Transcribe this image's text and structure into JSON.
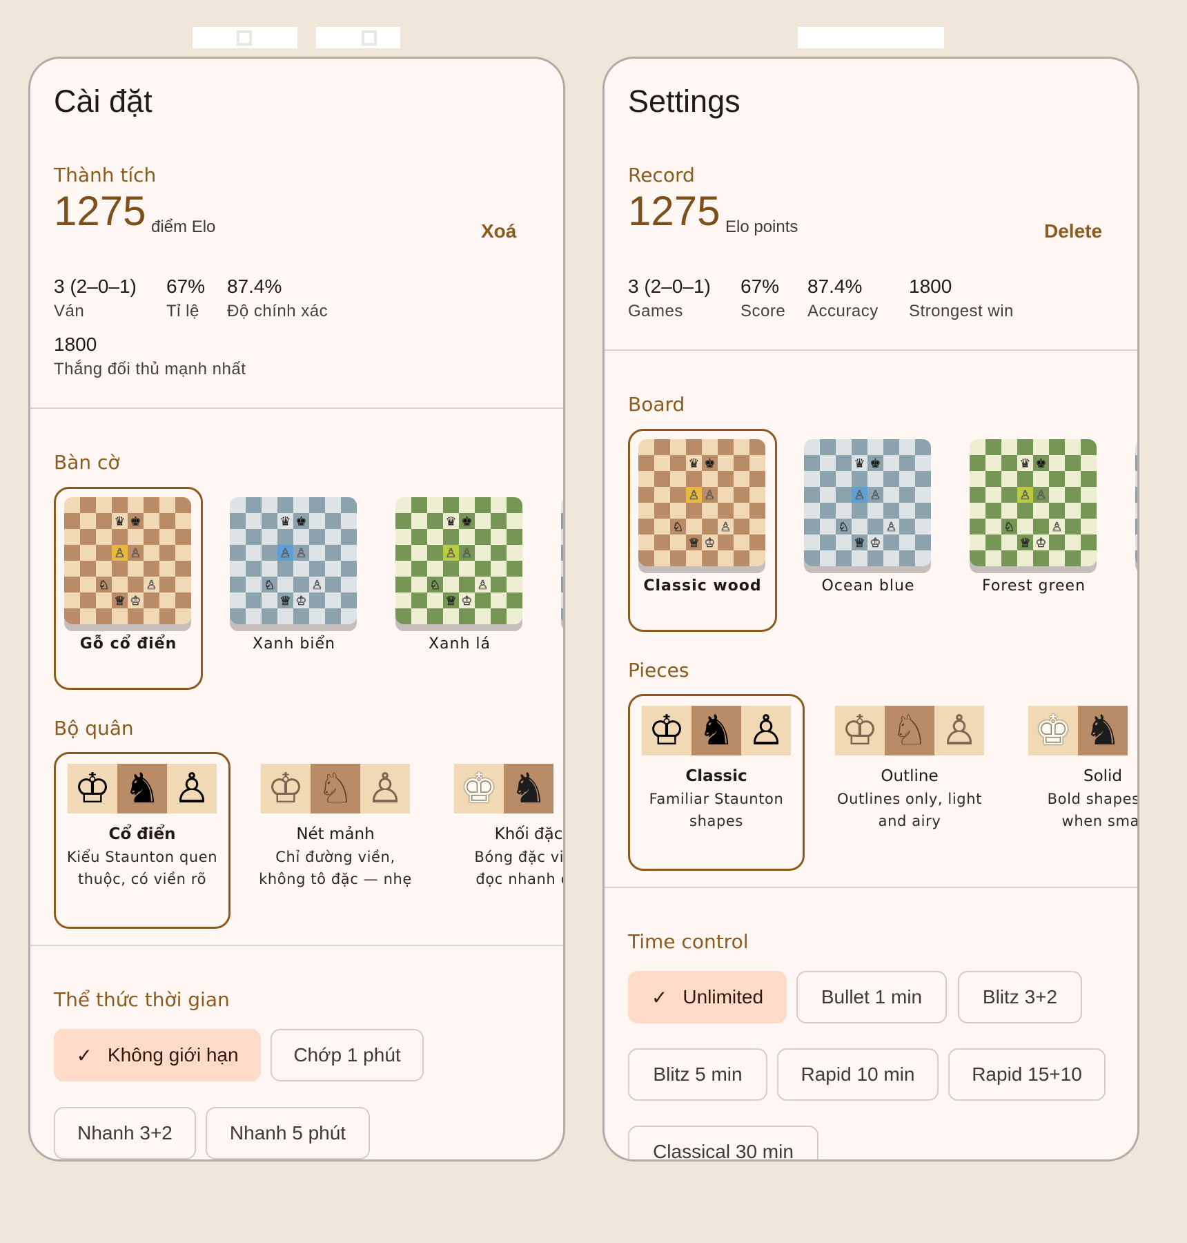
{
  "left": {
    "title": "Cài đặt",
    "record": {
      "heading": "Thành tích",
      "elo": "1275",
      "elo_label": "điểm Elo",
      "delete": "Xoá",
      "stats": [
        {
          "value": "3 (2–0–1)",
          "label": "Ván"
        },
        {
          "value": "67%",
          "label": "Tỉ lệ"
        },
        {
          "value": "87.4%",
          "label": "Độ chính xác"
        },
        {
          "value": "1800",
          "label": "Thắng đối thủ mạnh nhất"
        }
      ]
    },
    "board": {
      "heading": "Bàn cờ",
      "options": [
        {
          "label": "Gỗ cổ điển",
          "selected": true
        },
        {
          "label": "Xanh biển",
          "selected": false
        },
        {
          "label": "Xanh lá",
          "selected": false
        }
      ]
    },
    "pieces": {
      "heading": "Bộ quân",
      "options": [
        {
          "name": "Cổ điển",
          "desc1": "Kiểu Staunton quen",
          "desc2": "thuộc, có viền rõ",
          "selected": true
        },
        {
          "name": "Nét mảnh",
          "desc1": "Chỉ đường viền,",
          "desc2": "không tô đặc — nhẹ",
          "selected": false
        },
        {
          "name": "Khối đặc",
          "desc1": "Bóng đặc viền",
          "desc2": "đọc nhanh ở r",
          "selected": false
        }
      ]
    },
    "time": {
      "heading": "Thể thức thời gian",
      "options": [
        "Không giới hạn",
        "Chớp 1 phút",
        "Nhanh 3+2",
        "Nhanh 5 phút"
      ]
    }
  },
  "right": {
    "title": "Settings",
    "record": {
      "heading": "Record",
      "elo": "1275",
      "elo_label": "Elo points",
      "delete": "Delete",
      "stats": [
        {
          "value": "3 (2–0–1)",
          "label": "Games"
        },
        {
          "value": "67%",
          "label": "Score"
        },
        {
          "value": "87.4%",
          "label": "Accuracy"
        },
        {
          "value": "1800",
          "label": "Strongest win"
        }
      ]
    },
    "board": {
      "heading": "Board",
      "options": [
        {
          "label": "Classic wood",
          "selected": true
        },
        {
          "label": "Ocean blue",
          "selected": false
        },
        {
          "label": "Forest green",
          "selected": false
        }
      ]
    },
    "pieces": {
      "heading": "Pieces",
      "options": [
        {
          "name": "Classic",
          "desc1": "Familiar Staunton",
          "desc2": "shapes",
          "selected": true
        },
        {
          "name": "Outline",
          "desc1": "Outlines only, light",
          "desc2": "and airy",
          "selected": false
        },
        {
          "name": "Solid",
          "desc1": "Bold shapes, c",
          "desc2": "when smal",
          "selected": false
        }
      ]
    },
    "time": {
      "heading": "Time control",
      "options": [
        "Unlimited",
        "Bullet 1 min",
        "Blitz 3+2",
        "Blitz 5 min",
        "Rapid 10 min",
        "Rapid 15+10",
        "Classical 30 min"
      ]
    }
  },
  "themes": {
    "wood": {
      "light": "#f1d9b5",
      "dark": "#b98c67",
      "highlight": "#e8b93e"
    },
    "blue": {
      "light": "#dee3e6",
      "dark": "#8ca2ad",
      "highlight": "#5f9fd4"
    },
    "green": {
      "light": "#eeeed2",
      "dark": "#769656",
      "highlight": "#b9ca43"
    },
    "accent": "#8b5a1c",
    "selected_chip": "#fedbc8"
  },
  "icons": {
    "check": "check-icon",
    "king": "king-icon",
    "knight": "knight-icon",
    "pawn": "pawn-icon",
    "queen": "queen-icon"
  }
}
